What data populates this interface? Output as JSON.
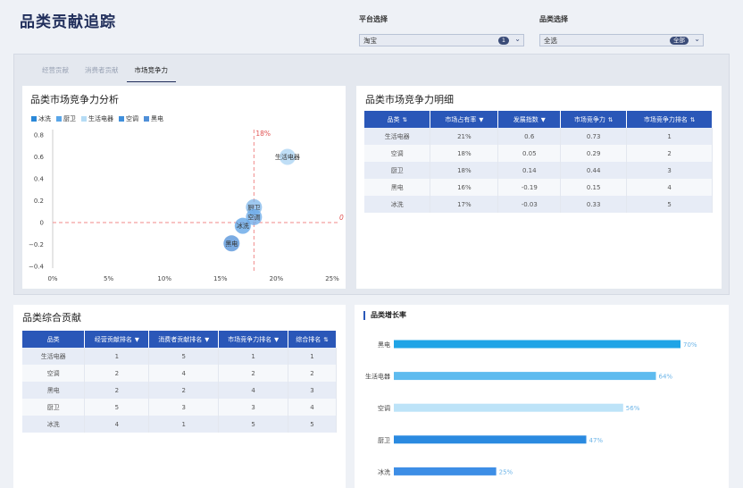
{
  "header": {
    "title": "品类贡献追踪",
    "platform_label": "平台选择",
    "platform_value": "淘宝",
    "platform_badge": "1",
    "category_label": "品类选择",
    "category_value": "全选",
    "category_badge": "全部"
  },
  "tabs": [
    {
      "label": "经营贡献",
      "active": false
    },
    {
      "label": "消费者贡献",
      "active": false
    },
    {
      "label": "市场竞争力",
      "active": true
    }
  ],
  "scatter_panel": {
    "title": "品类市场竞争力分析",
    "legend": [
      "冰洗",
      "厨卫",
      "生活电器",
      "空调",
      "黑电"
    ],
    "x_ref_label": "18%",
    "y_ref_label": "0"
  },
  "chart_data": [
    {
      "type": "scatter",
      "title": "品类市场竞争力分析",
      "xlim": [
        0,
        0.25
      ],
      "ylim": [
        -0.4,
        0.8
      ],
      "x_ticks": [
        "0%",
        "5%",
        "10%",
        "15%",
        "20%",
        "25%"
      ],
      "y_ticks": [
        "0.8",
        "0.6",
        "0.4",
        "0.2",
        "0",
        "−0.2",
        "−0.4"
      ],
      "reference_lines": {
        "x": 0.18,
        "y": 0
      },
      "grid": false,
      "legend_position": "top-left",
      "series": [
        {
          "name": "冰洗",
          "color": "#5aa0e6",
          "points": [
            {
              "x": 0.17,
              "y": -0.03,
              "label": "冰洗"
            }
          ]
        },
        {
          "name": "厨卫",
          "color": "#7db6ea",
          "points": [
            {
              "x": 0.18,
              "y": 0.14,
              "label": "厨卫"
            }
          ]
        },
        {
          "name": "生活电器",
          "color": "#a9d3f3",
          "points": [
            {
              "x": 0.21,
              "y": 0.6,
              "label": "生活电器"
            }
          ]
        },
        {
          "name": "空调",
          "color": "#6aaae8",
          "points": [
            {
              "x": 0.18,
              "y": 0.05,
              "label": "空调"
            }
          ]
        },
        {
          "name": "黑电",
          "color": "#4f8fd8",
          "points": [
            {
              "x": 0.16,
              "y": -0.19,
              "label": "黑电"
            }
          ]
        }
      ]
    },
    {
      "type": "bar",
      "title": "品类增长率",
      "orientation": "horizontal",
      "categories": [
        "黑电",
        "生活电器",
        "空调",
        "厨卫",
        "冰洗"
      ],
      "values": [
        70,
        64,
        56,
        47,
        25
      ],
      "value_labels": [
        "70%",
        "64%",
        "56%",
        "47%",
        "25%"
      ],
      "colors": [
        "#1fa4e6",
        "#5ebbef",
        "#bde3f8",
        "#2a8ae0",
        "#3d8ee6"
      ],
      "xlim": [
        0,
        100
      ]
    }
  ],
  "detail_table": {
    "title": "品类市场竞争力明细",
    "headers": [
      {
        "label": "品类",
        "icon": "⇅"
      },
      {
        "label": "市场占有率",
        "icon": "▼"
      },
      {
        "label": "发展指数",
        "icon": "▼"
      },
      {
        "label": "市场竞争力",
        "icon": "⇅"
      },
      {
        "label": "市场竞争力排名",
        "icon": "⇅"
      }
    ],
    "rows": [
      [
        "生活电器",
        "21%",
        "0.6",
        "0.73",
        "1"
      ],
      [
        "空调",
        "18%",
        "0.05",
        "0.29",
        "2"
      ],
      [
        "厨卫",
        "18%",
        "0.14",
        "0.44",
        "3"
      ],
      [
        "黑电",
        "16%",
        "-0.19",
        "0.15",
        "4"
      ],
      [
        "冰洗",
        "17%",
        "-0.03",
        "0.33",
        "5"
      ]
    ]
  },
  "contrib_table": {
    "title": "品类综合贡献",
    "headers": [
      {
        "label": "品类",
        "icon": ""
      },
      {
        "label": "经营贡献排名",
        "icon": "▼"
      },
      {
        "label": "消费者贡献排名",
        "icon": "▼"
      },
      {
        "label": "市场竞争力排名",
        "icon": "▼"
      },
      {
        "label": "综合排名",
        "icon": "⇅"
      }
    ],
    "rows": [
      [
        "生活电器",
        "1",
        "5",
        "1",
        "1"
      ],
      [
        "空调",
        "2",
        "4",
        "2",
        "2"
      ],
      [
        "黑电",
        "2",
        "2",
        "4",
        "3"
      ],
      [
        "厨卫",
        "5",
        "3",
        "3",
        "4"
      ],
      [
        "冰洗",
        "4",
        "1",
        "5",
        "5"
      ]
    ]
  },
  "growth_panel": {
    "title": "品类增长率"
  }
}
